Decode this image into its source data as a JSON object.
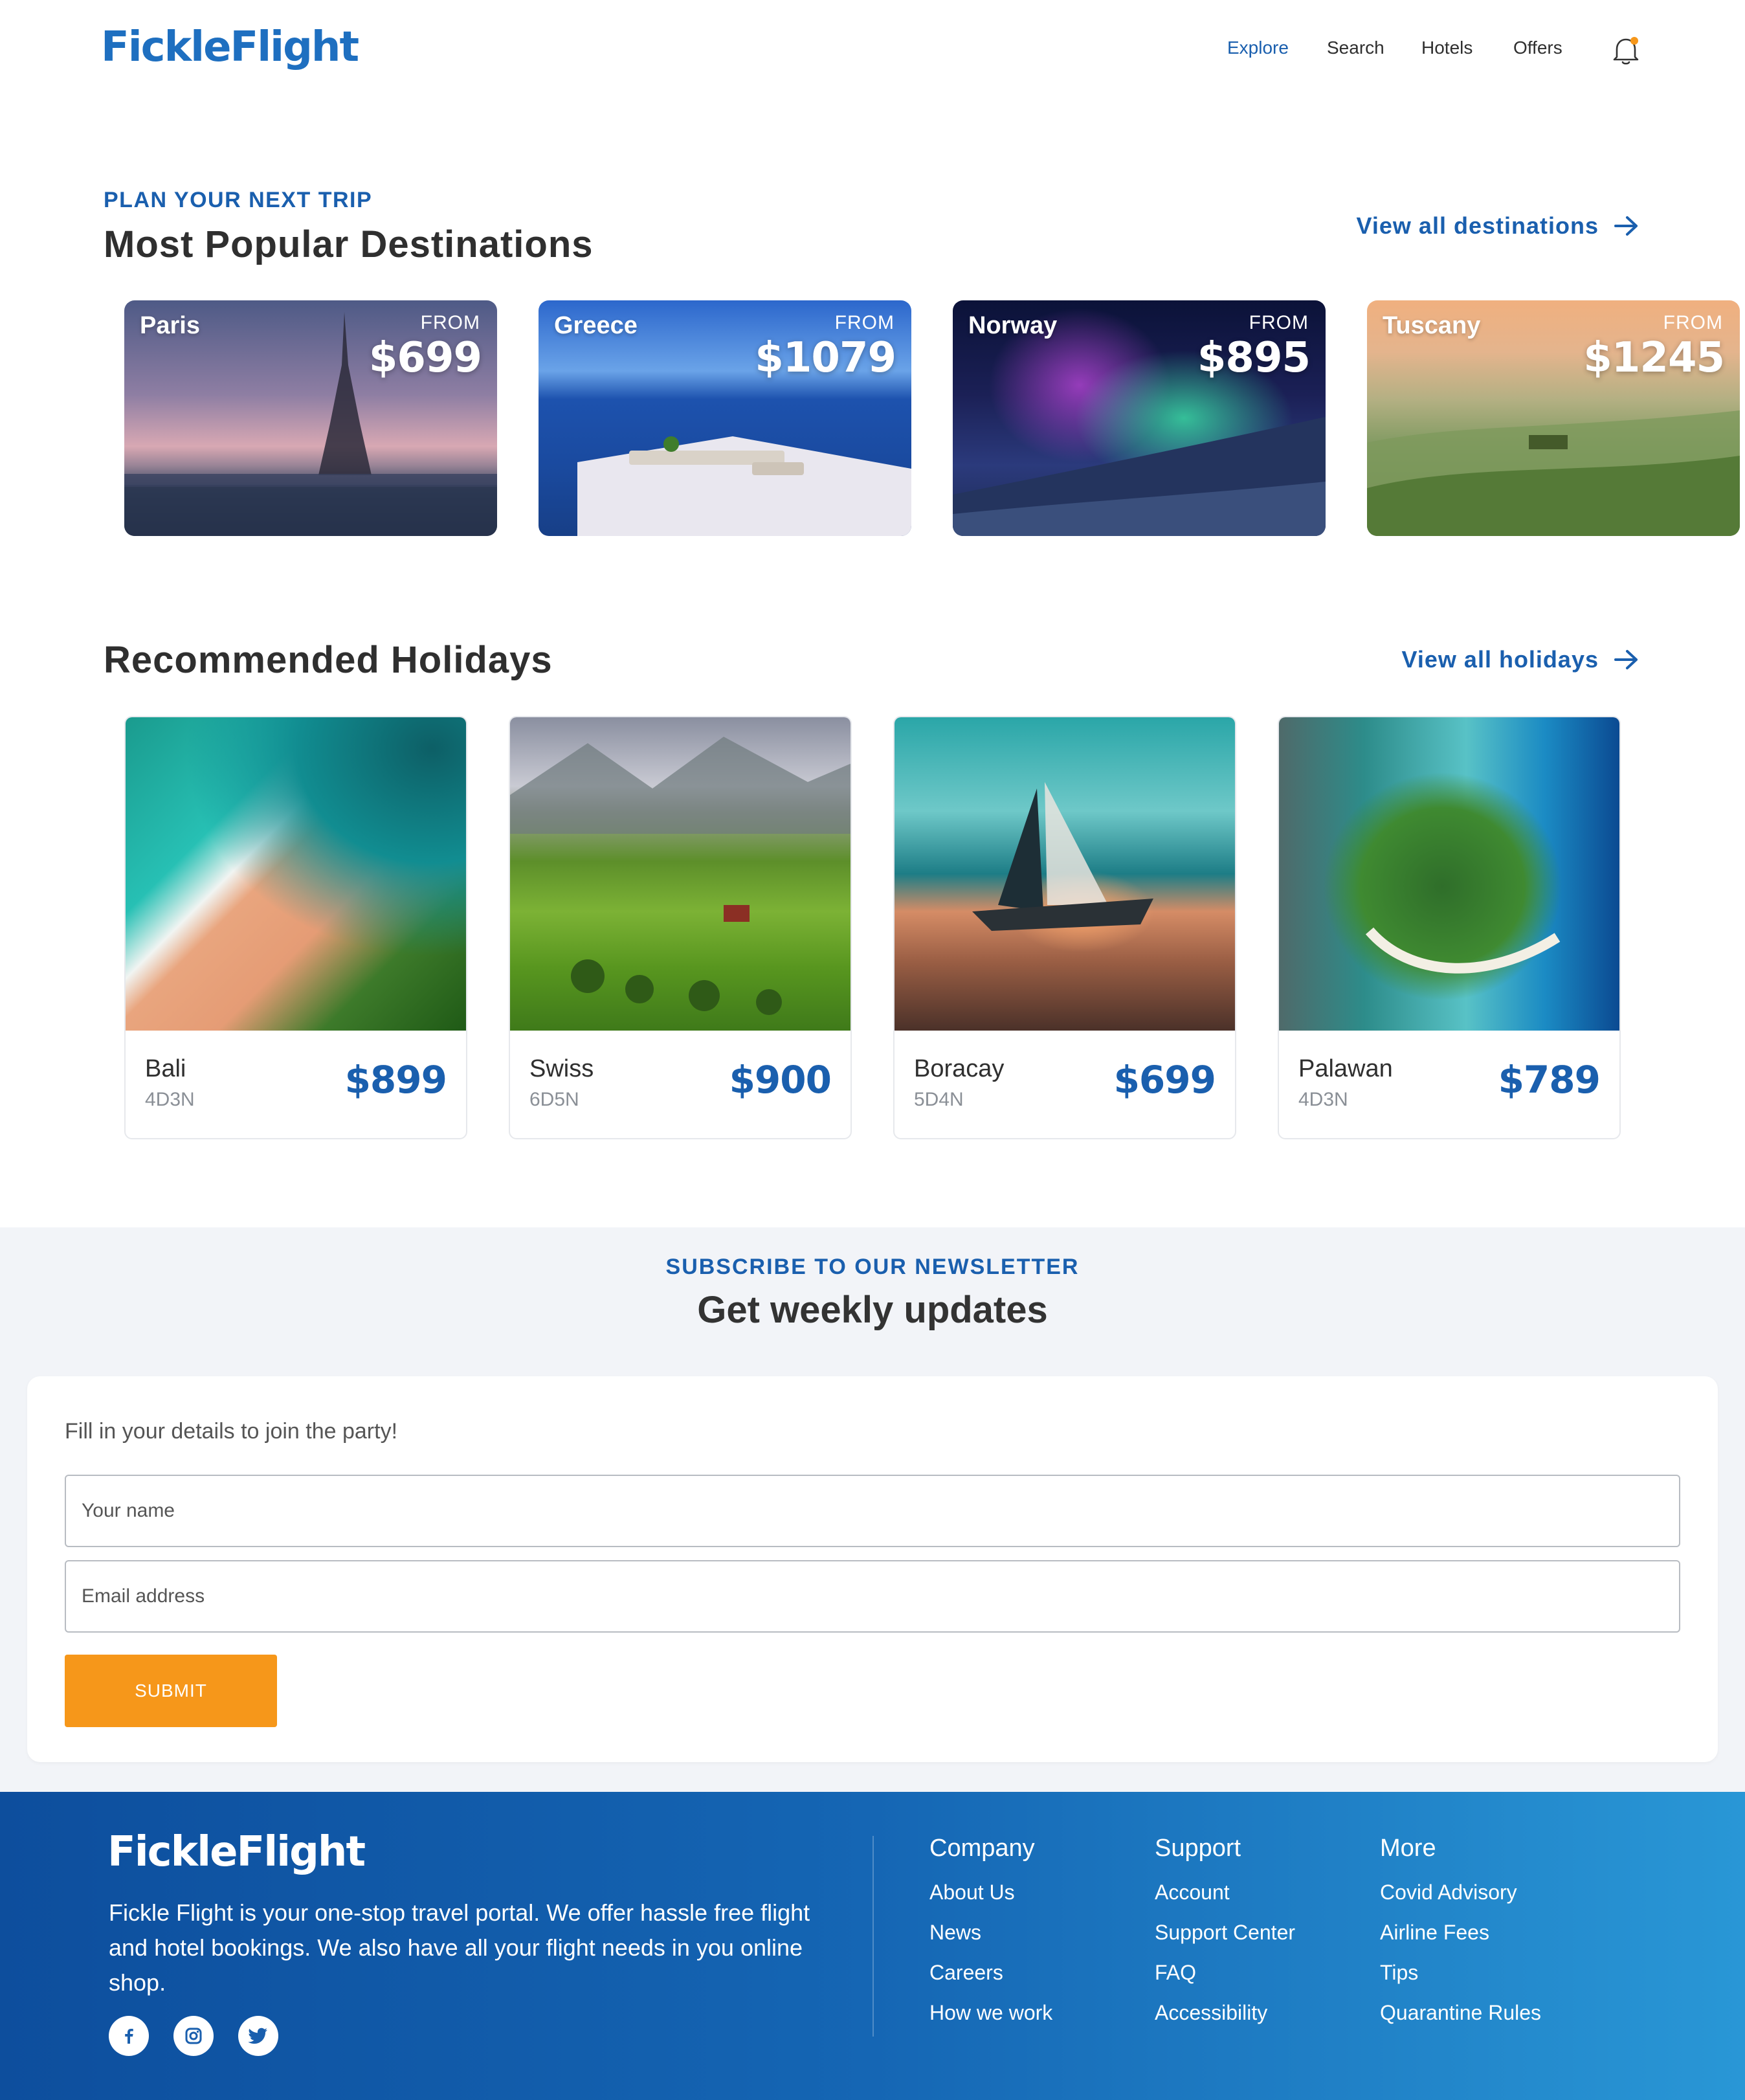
{
  "header": {
    "logo": "FickleFlight",
    "nav": [
      {
        "label": "Explore",
        "active": true
      },
      {
        "label": "Search",
        "active": false
      },
      {
        "label": "Hotels",
        "active": false
      },
      {
        "label": "Offers",
        "active": false
      }
    ],
    "notification_icon": "bell-icon",
    "notification_badge_color": "#f6971a"
  },
  "destinations": {
    "eyebrow": "PLAN YOUR NEXT TRIP",
    "title": "Most Popular Destinations",
    "view_all": "View all destinations",
    "items": [
      {
        "name": "Paris",
        "from_label": "FROM",
        "price": "$699"
      },
      {
        "name": "Greece",
        "from_label": "FROM",
        "price": "$1079"
      },
      {
        "name": "Norway",
        "from_label": "FROM",
        "price": "$895"
      },
      {
        "name": "Tuscany",
        "from_label": "FROM",
        "price": "$1245"
      }
    ]
  },
  "holidays": {
    "title": "Recommended Holidays",
    "view_all": "View all holidays",
    "items": [
      {
        "name": "Bali",
        "duration": "4D3N",
        "price": "$899"
      },
      {
        "name": "Swiss",
        "duration": "6D5N",
        "price": "$900"
      },
      {
        "name": "Boracay",
        "duration": "5D4N",
        "price": "$699"
      },
      {
        "name": "Palawan",
        "duration": "4D3N",
        "price": "$789"
      }
    ]
  },
  "newsletter": {
    "eyebrow": "SUBSCRIBE TO OUR NEWSLETTER",
    "title": "Get weekly updates",
    "intro": "Fill in your details to join the party!",
    "name_placeholder": "Your name",
    "email_placeholder": "Email address",
    "submit_label": "SUBMIT"
  },
  "footer": {
    "logo": "FickleFlight",
    "description": "Fickle Flight is your one-stop travel portal. We offer hassle free flight and hotel bookings. We also have all your flight needs in you online shop.",
    "social": [
      "facebook-icon",
      "instagram-icon",
      "twitter-icon"
    ],
    "columns": [
      {
        "title": "Company",
        "links": [
          "About Us",
          "News",
          "Careers",
          "How we work"
        ]
      },
      {
        "title": "Support",
        "links": [
          "Account",
          "Support Center",
          "FAQ",
          "Accessibility"
        ]
      },
      {
        "title": "More",
        "links": [
          "Covid Advisory",
          "Airline Fees",
          "Tips",
          "Quarantine Rules"
        ]
      }
    ]
  },
  "colors": {
    "brand_blue": "#1a5fae",
    "accent_orange": "#f6971a",
    "footer_gradient_start": "#0d4e9d",
    "footer_gradient_end": "#2997d6"
  }
}
